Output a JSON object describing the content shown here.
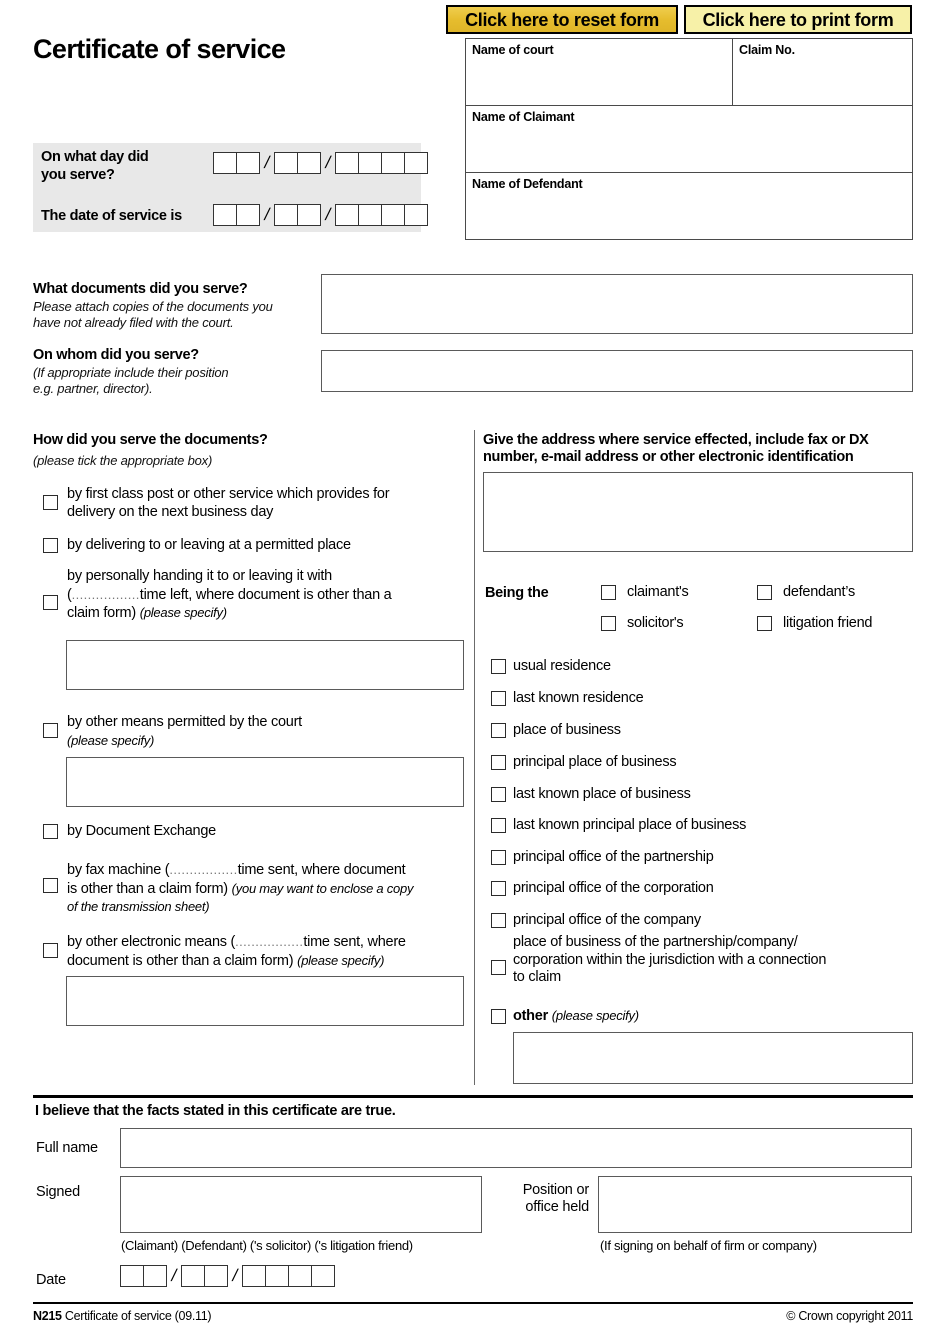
{
  "page": {
    "title": "Certificate of service"
  },
  "toolbar": {
    "reset_label": "Click here to reset form",
    "print_label": "Click here to print form"
  },
  "header_box": {
    "court_label": "Name of court",
    "court_value": "",
    "claim_no_label": "Claim No.",
    "claim_no_value": "",
    "claimant_label": "Name of Claimant",
    "claimant_value": "",
    "defendant_label": "Name of Defendant",
    "defendant_value": ""
  },
  "dates": {
    "served_label_line1": "On what day did",
    "served_label_line2": "you serve?",
    "service_label": "The date of service is",
    "served_value": {
      "dd": [
        "",
        ""
      ],
      "mm": [
        "",
        ""
      ],
      "yyyy": [
        "",
        "",
        "",
        ""
      ]
    },
    "service_value": {
      "dd": [
        "",
        ""
      ],
      "mm": [
        "",
        ""
      ],
      "yyyy": [
        "",
        "",
        "",
        ""
      ]
    },
    "separator": "/"
  },
  "documents": {
    "question": "What documents did you serve?",
    "hint_line1": "Please attach copies of the documents you",
    "hint_line2": "have not already filed with the court.",
    "value": ""
  },
  "on_whom": {
    "question": "On whom did you serve?",
    "hint_line1": "(If appropriate include their position",
    "hint_line2": "e.g. partner, director).",
    "value": ""
  },
  "how_served": {
    "question": "How did you serve the documents?",
    "hint": "(please tick the appropriate box)",
    "options": [
      {
        "id": "first-class-post",
        "line1": "by first class post or other service which provides for",
        "line2": "delivery on the next business day",
        "checked": false
      },
      {
        "id": "permitted-place",
        "line1": "by delivering to or leaving at a permitted place",
        "checked": false
      },
      {
        "id": "personally-handing",
        "pre_line": "by personally handing it to or leaving it with",
        "line_a_open": "(",
        "dots": ".................",
        "line_a_rest": "time left, where document is other than a",
        "line_b": "claim form)",
        "line_b_italic": "(please specify)",
        "checked": false,
        "specify_value": ""
      },
      {
        "id": "other-means-court",
        "line1": "by other means permitted by the court",
        "italic_line": "(please specify)",
        "checked": false,
        "specify_value": ""
      },
      {
        "id": "document-exchange",
        "line1": "by Document Exchange",
        "checked": false
      },
      {
        "id": "fax-machine",
        "line1_open": "by fax machine (",
        "dots": ".................",
        "line1_rest": "time sent, where document",
        "line2": "is other than a claim form)",
        "line2_italic": "(you may want to enclose a copy",
        "line3_italic": "of the transmission sheet)",
        "checked": false
      },
      {
        "id": "other-electronic-means",
        "line1_open": "by other electronic means (",
        "dots": ".................",
        "line1_rest": "time sent, where",
        "line2": "document is other than a claim form)",
        "line2_italic": "(please specify)",
        "checked": false,
        "specify_value": ""
      }
    ]
  },
  "address": {
    "heading_line1": "Give the address where service effected, include fax or DX",
    "heading_line2": "number, e-mail address or other electronic identification",
    "value": ""
  },
  "being_the": {
    "label": "Being the",
    "options": [
      {
        "id": "claimants",
        "label": "claimant's",
        "checked": false
      },
      {
        "id": "defendants",
        "label": "defendant’s",
        "checked": false
      },
      {
        "id": "solicitors",
        "label": "solicitor's",
        "checked": false
      },
      {
        "id": "litigation-friend",
        "label": "litigation friend",
        "checked": false
      }
    ]
  },
  "place_options": [
    {
      "id": "usual-residence",
      "label": "usual residence",
      "checked": false
    },
    {
      "id": "last-known-residence",
      "label": "last known residence",
      "checked": false
    },
    {
      "id": "place-of-business",
      "label": "place of business",
      "checked": false
    },
    {
      "id": "principal-place-of-business",
      "label": "principal place of business",
      "checked": false
    },
    {
      "id": "last-known-place-of-business",
      "label": "last known place of business",
      "checked": false
    },
    {
      "id": "last-known-principal-place-of-business",
      "label": "last known principal place of business",
      "checked": false
    },
    {
      "id": "principal-office-partnership",
      "label": "principal office of the partnership",
      "checked": false
    },
    {
      "id": "principal-office-corporation",
      "label": "principal office of the corporation",
      "checked": false
    },
    {
      "id": "principal-office-company",
      "label": "principal office of the company",
      "checked": false
    }
  ],
  "place_jurisdiction": {
    "id": "place-of-business-jurisdiction",
    "line1": "place of business of the partnership/company/",
    "line2": "corporation within the jurisdiction with a connection",
    "line3": "to claim",
    "checked": false
  },
  "place_other": {
    "id": "other-place",
    "label": "other",
    "italic": "(please specify)",
    "checked": false,
    "value": ""
  },
  "declaration": {
    "statement": "I believe that the facts stated in this certificate are true.",
    "full_name_label": "Full name",
    "full_name_value": "",
    "signed_label": "Signed",
    "signed_value": "",
    "signed_caption": "(Claimant) (Defendant) ('s solicitor) ('s litigation friend)",
    "position_label_line1": "Position or",
    "position_label_line2": "office held",
    "position_value": "",
    "position_caption": "(If signing on behalf of firm or company)",
    "date_label": "Date",
    "date_value": {
      "dd": [
        "",
        ""
      ],
      "mm": [
        "",
        ""
      ],
      "yyyy": [
        "",
        "",
        "",
        ""
      ]
    }
  },
  "footer": {
    "form_code": "N215",
    "form_name": "Certificate of service (09.11)",
    "copyright": "© Crown copyright 2011"
  }
}
